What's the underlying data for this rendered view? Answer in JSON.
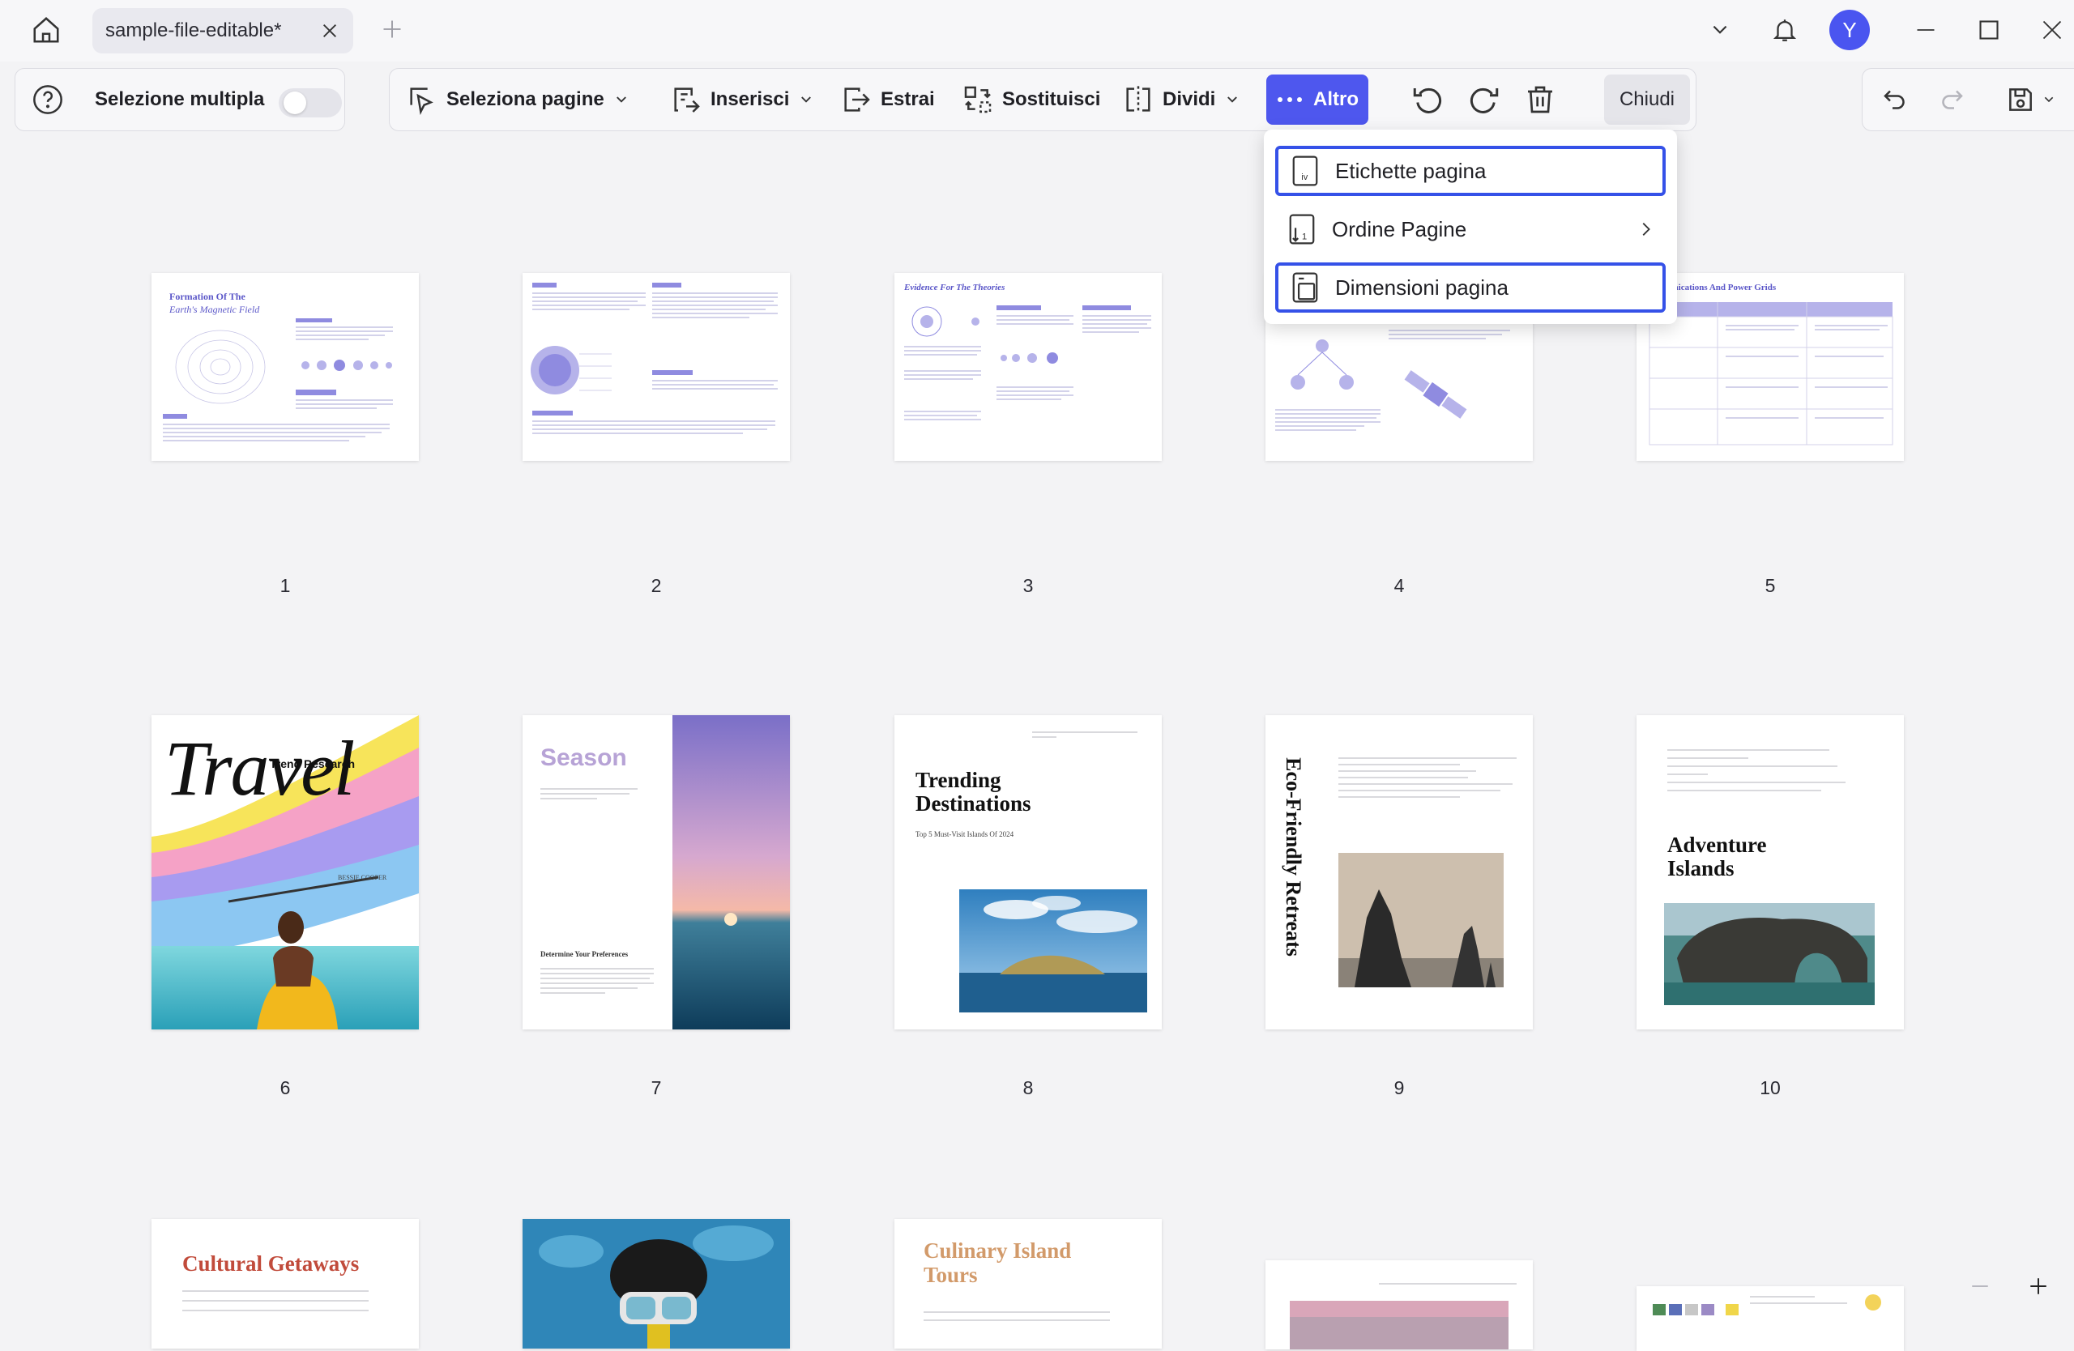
{
  "titlebar": {
    "tab_label": "sample-file-editable*",
    "avatar_initial": "Y"
  },
  "toolbar": {
    "multi_select_label": "Selezione multipla",
    "select_pages_label": "Seleziona pagine",
    "insert_label": "Inserisci",
    "extract_label": "Estrai",
    "replace_label": "Sostituisci",
    "split_label": "Dividi",
    "more_label": "Altro",
    "close_label": "Chiudi"
  },
  "more_menu": {
    "items": [
      {
        "label": "Etichette pagina",
        "icon": "page-label-icon",
        "highlighted": true
      },
      {
        "label": "Ordine Pagine",
        "icon": "page-order-icon",
        "submenu": true
      },
      {
        "label": "Dimensioni pagina",
        "icon": "page-size-icon",
        "highlighted": true
      }
    ]
  },
  "pages": [
    {
      "number": "1",
      "title": "Formation Of The",
      "subtitle": "Earth's Magnetic Field"
    },
    {
      "number": "2"
    },
    {
      "number": "3",
      "title": "Evidence For The Theories"
    },
    {
      "number": "4"
    },
    {
      "number": "5",
      "title": "e Communications And Power Grids"
    },
    {
      "number": "6",
      "title": "Travel",
      "subtitle": "Trend Research",
      "author": "BESSIE COOPER"
    },
    {
      "number": "7",
      "title": "Season",
      "subtitle": "Determine Your Preferences"
    },
    {
      "number": "8",
      "title": "Trending Destinations",
      "subtitle": "Top 5 Must-Visit Islands Of 2024"
    },
    {
      "number": "9",
      "title": "Eco-Friendly Retreats"
    },
    {
      "number": "10",
      "title": "Adventure Islands"
    },
    {
      "title": "Cultural Getaways"
    },
    {
      "title": ""
    },
    {
      "title": "Culinary Island Tours"
    },
    {
      "title": ""
    },
    {
      "title": ""
    }
  ],
  "colors": {
    "accent": "#4e57ee",
    "highlight_border": "#3551e8",
    "avatar": "#4a55f0"
  }
}
